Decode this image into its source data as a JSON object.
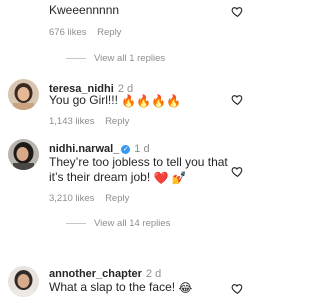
{
  "comments": [
    {
      "text": "Kweeennnnn",
      "likes": "676 likes",
      "reply": "Reply",
      "view_replies": "View all 1 replies"
    },
    {
      "username": "teresa_nidhi",
      "age": "2 d",
      "text": "You go Girl!!!",
      "likes": "1,143 likes",
      "reply": "Reply"
    },
    {
      "username": "nidhi.narwal_",
      "age": "1 d",
      "text_line1": "They’re too jobless to tell you that",
      "text_line2": "it’s their dream job!",
      "likes": "3,210 likes",
      "reply": "Reply",
      "view_replies": "View all 14 replies"
    },
    {
      "username": "annother_chapter",
      "age": "2 d",
      "text": "What a slap to the face!"
    }
  ],
  "icons": {
    "like": "heart-outline-icon",
    "verified": "verified-badge-icon"
  }
}
